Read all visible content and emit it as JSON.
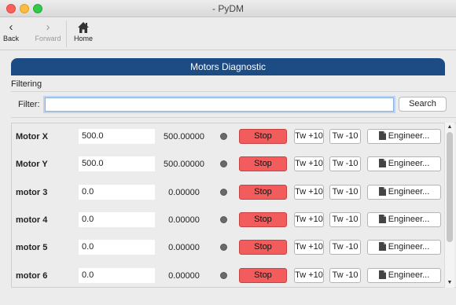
{
  "window": {
    "title": "- PyDM"
  },
  "toolbar": {
    "back_label": "Back",
    "forward_label": "Forward",
    "home_label": "Home",
    "back_icon": "chevron-left",
    "forward_icon": "chevron-right",
    "home_icon": "house"
  },
  "header": {
    "title": "Motors Diagnostic",
    "color": "#1d4c84"
  },
  "filtering": {
    "group_label": "Filtering",
    "filter_label": "Filter:",
    "filter_value": "",
    "search_label": "Search"
  },
  "motors": [
    {
      "name": "Motor X",
      "setpoint": "500.0",
      "readback": "500.00000",
      "stop": "Stop",
      "tw_plus": "Tw +10",
      "tw_minus": "Tw -10",
      "engineer": "Engineer..."
    },
    {
      "name": "Motor Y",
      "setpoint": "500.0",
      "readback": "500.00000",
      "stop": "Stop",
      "tw_plus": "Tw +10",
      "tw_minus": "Tw -10",
      "engineer": "Engineer..."
    },
    {
      "name": "motor 3",
      "setpoint": "0.0",
      "readback": "0.00000",
      "stop": "Stop",
      "tw_plus": "Tw +10",
      "tw_minus": "Tw -10",
      "engineer": "Engineer..."
    },
    {
      "name": "motor 4",
      "setpoint": "0.0",
      "readback": "0.00000",
      "stop": "Stop",
      "tw_plus": "Tw +10",
      "tw_minus": "Tw -10",
      "engineer": "Engineer..."
    },
    {
      "name": "motor 5",
      "setpoint": "0.0",
      "readback": "0.00000",
      "stop": "Stop",
      "tw_plus": "Tw +10",
      "tw_minus": "Tw -10",
      "engineer": "Engineer..."
    },
    {
      "name": "motor 6",
      "setpoint": "0.0",
      "readback": "0.00000",
      "stop": "Stop",
      "tw_plus": "Tw +10",
      "tw_minus": "Tw -10",
      "engineer": "Engineer..."
    }
  ],
  "colors": {
    "stop": "#f35c5c",
    "led": "#6a6a6a"
  }
}
